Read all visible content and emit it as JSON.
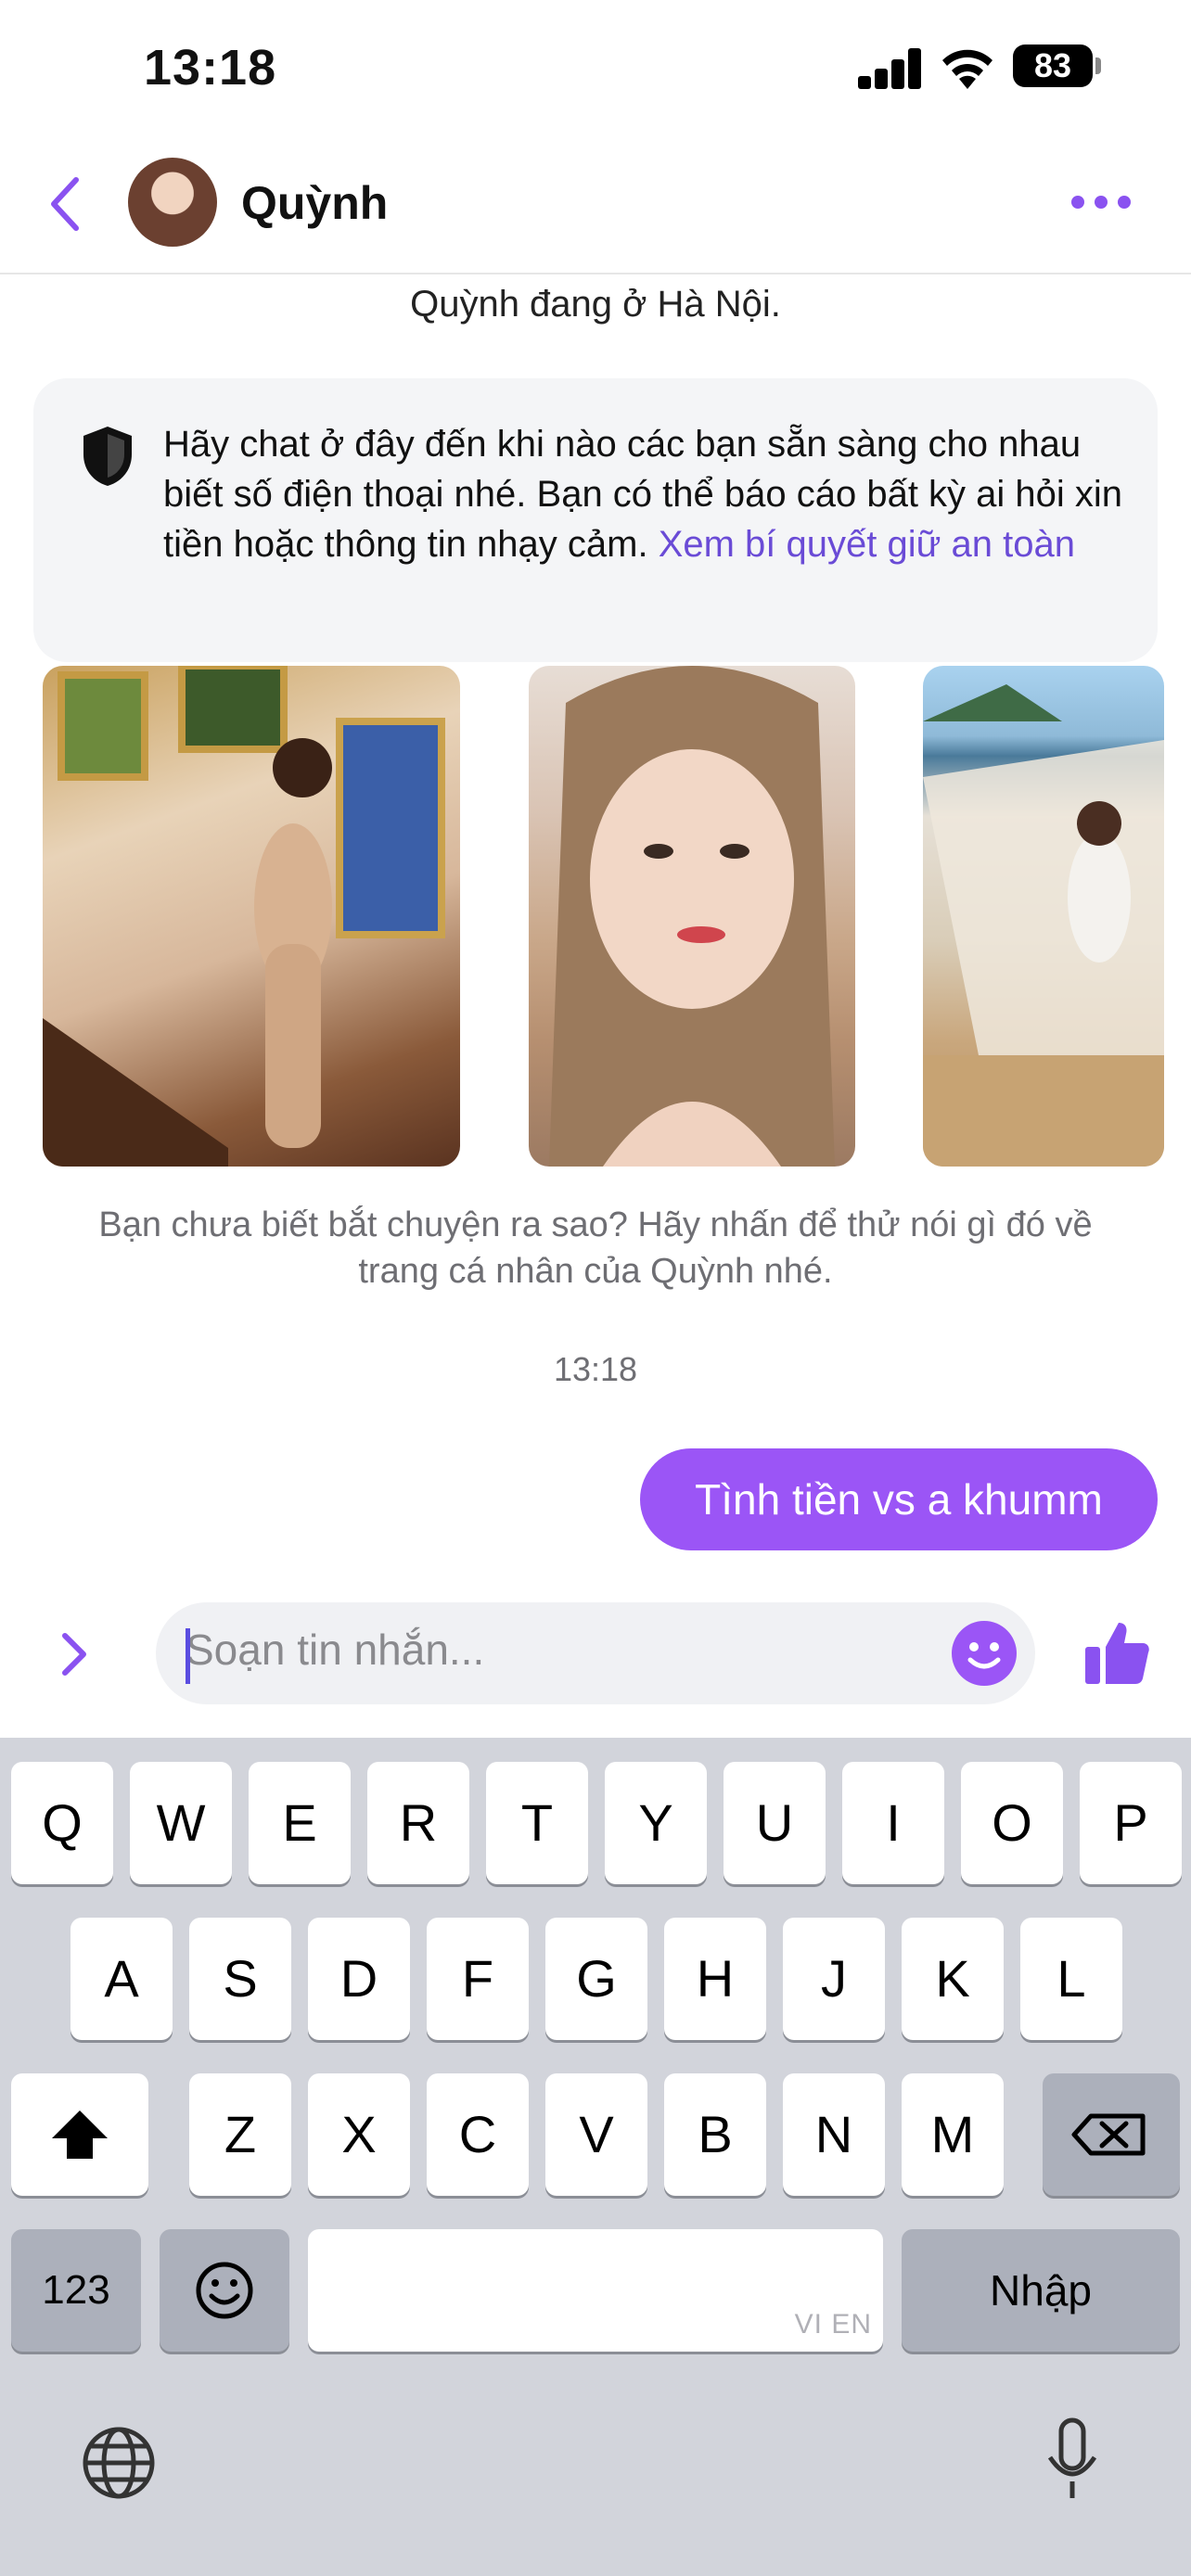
{
  "status_bar": {
    "time": "13:18",
    "battery": "83"
  },
  "header": {
    "contact_name": "Quỳnh"
  },
  "chat": {
    "cutoff_text": "· · · · · · · · ·",
    "location_text": "Quỳnh đang ở Hà Nội.",
    "safety_notice": "Hãy chat ở đây đến khi nào các bạn sẵn sàng cho nhau biết số điện thoại nhé. Bạn có thể báo cáo bất kỳ ai hỏi xin tiền hoặc thông tin nhạy cảm.",
    "safety_link": "Xem bí quyết giữ an toàn",
    "icebreaker_prompt": "Bạn chưa biết bắt chuyện ra sao? Hãy nhấn để thử nói gì đó về trang cá nhân của Quỳnh nhé.",
    "timestamp": "13:18",
    "sent_message": "Tình tiền vs a khumm"
  },
  "composer": {
    "placeholder": "Soạn tin nhắn..."
  },
  "keyboard": {
    "row1": [
      "Q",
      "W",
      "E",
      "R",
      "T",
      "Y",
      "U",
      "I",
      "O",
      "P"
    ],
    "row2": [
      "A",
      "S",
      "D",
      "F",
      "G",
      "H",
      "J",
      "K",
      "L"
    ],
    "row3": [
      "Z",
      "X",
      "C",
      "V",
      "B",
      "N",
      "M"
    ],
    "numbers_key": "123",
    "return_key": "Nhập",
    "space_hint": "VI EN"
  },
  "colors": {
    "accent": "#9b55f6",
    "link": "#6a4bd6",
    "keyboard_bg": "#d2d4db"
  }
}
